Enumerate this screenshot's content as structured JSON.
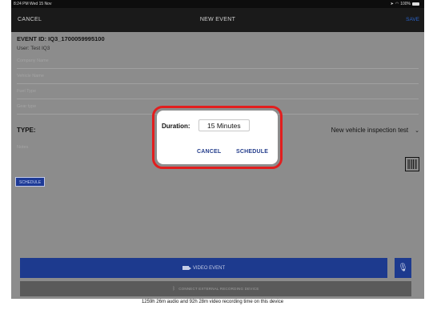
{
  "status_bar": {
    "time": "8:24 PM",
    "date": "Wed 15 Nov",
    "battery": "100%"
  },
  "nav": {
    "cancel": "CANCEL",
    "title": "NEW EVENT",
    "save": "SAVE"
  },
  "event": {
    "id": "EVENT ID: IQ3_1700059995100",
    "user": "User: Test IQ3"
  },
  "fields": {
    "company": "Company Name",
    "vehicle": "Vehicle Name",
    "fuel": "Fuel Type",
    "gear": "Gear type"
  },
  "type": {
    "label": "TYPE:",
    "value": "New vehicle inspection test"
  },
  "notes_placeholder": "Notes",
  "schedule_button": "SCHEDULE",
  "modal": {
    "duration_label": "Duration:",
    "duration_value": "15 Minutes",
    "cancel": "CANCEL",
    "schedule": "SCHEDULE"
  },
  "video_event": "VIDEO EVENT",
  "connect_device": "CONNECT EXTERNAL RECORDING DEVICE",
  "footer": "1259h 26m audio and 92h 28m video recording time on this device",
  "colors": {
    "accent": "#1d3a8e",
    "highlight_ring": "#e21e1e",
    "save": "#2a63c8"
  }
}
